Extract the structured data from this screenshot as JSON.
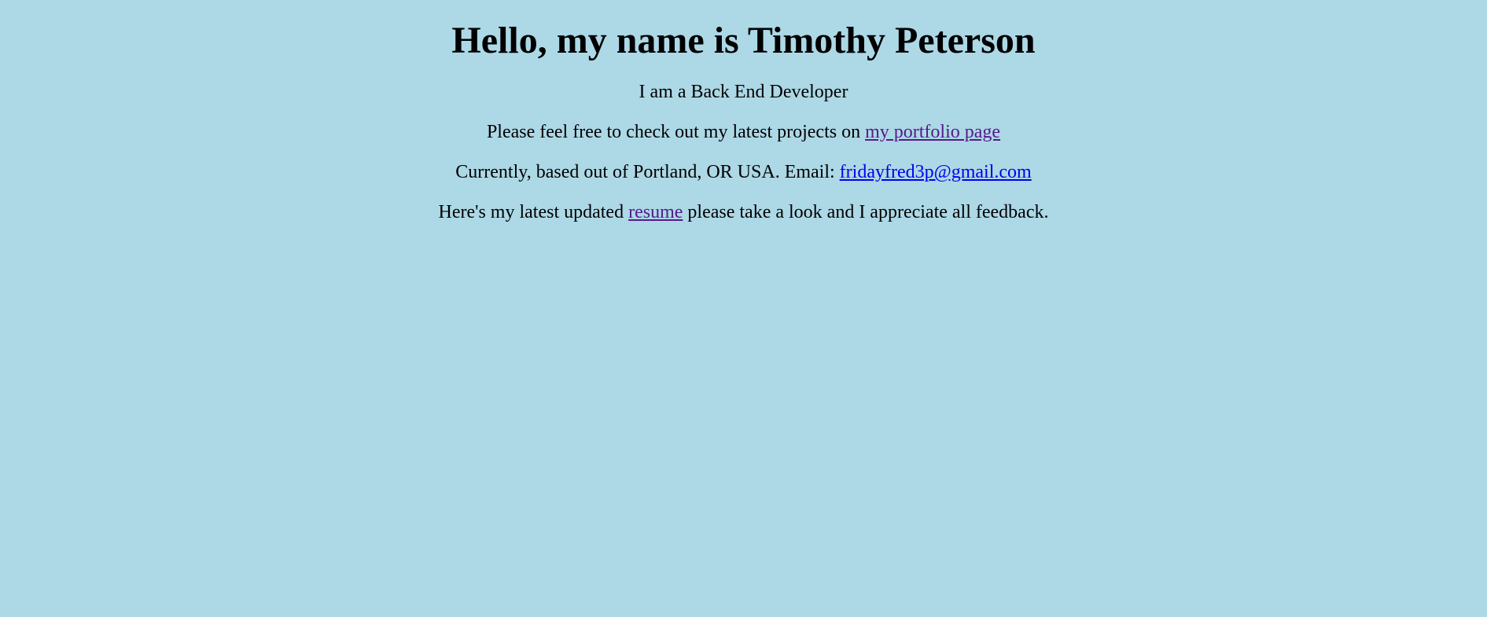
{
  "header": {
    "title": "Hello, my name is Timothy Peterson"
  },
  "intro": {
    "role": "I am a Back End Developer",
    "portfolio_prefix": "Please feel free to check out my latest projects on ",
    "portfolio_link": "my portfolio page",
    "location_prefix": "Currently, based out of Portland, OR USA. Email: ",
    "email_link": "fridayfred3p@gmail.com",
    "resume_prefix": "Here's my latest updated ",
    "resume_link": "resume",
    "resume_suffix": " please take a look and I appreciate all feedback."
  },
  "colors": {
    "background": "#add8e6",
    "text": "#000000",
    "visited_link": "#551a8b",
    "link": "#0000ee"
  }
}
